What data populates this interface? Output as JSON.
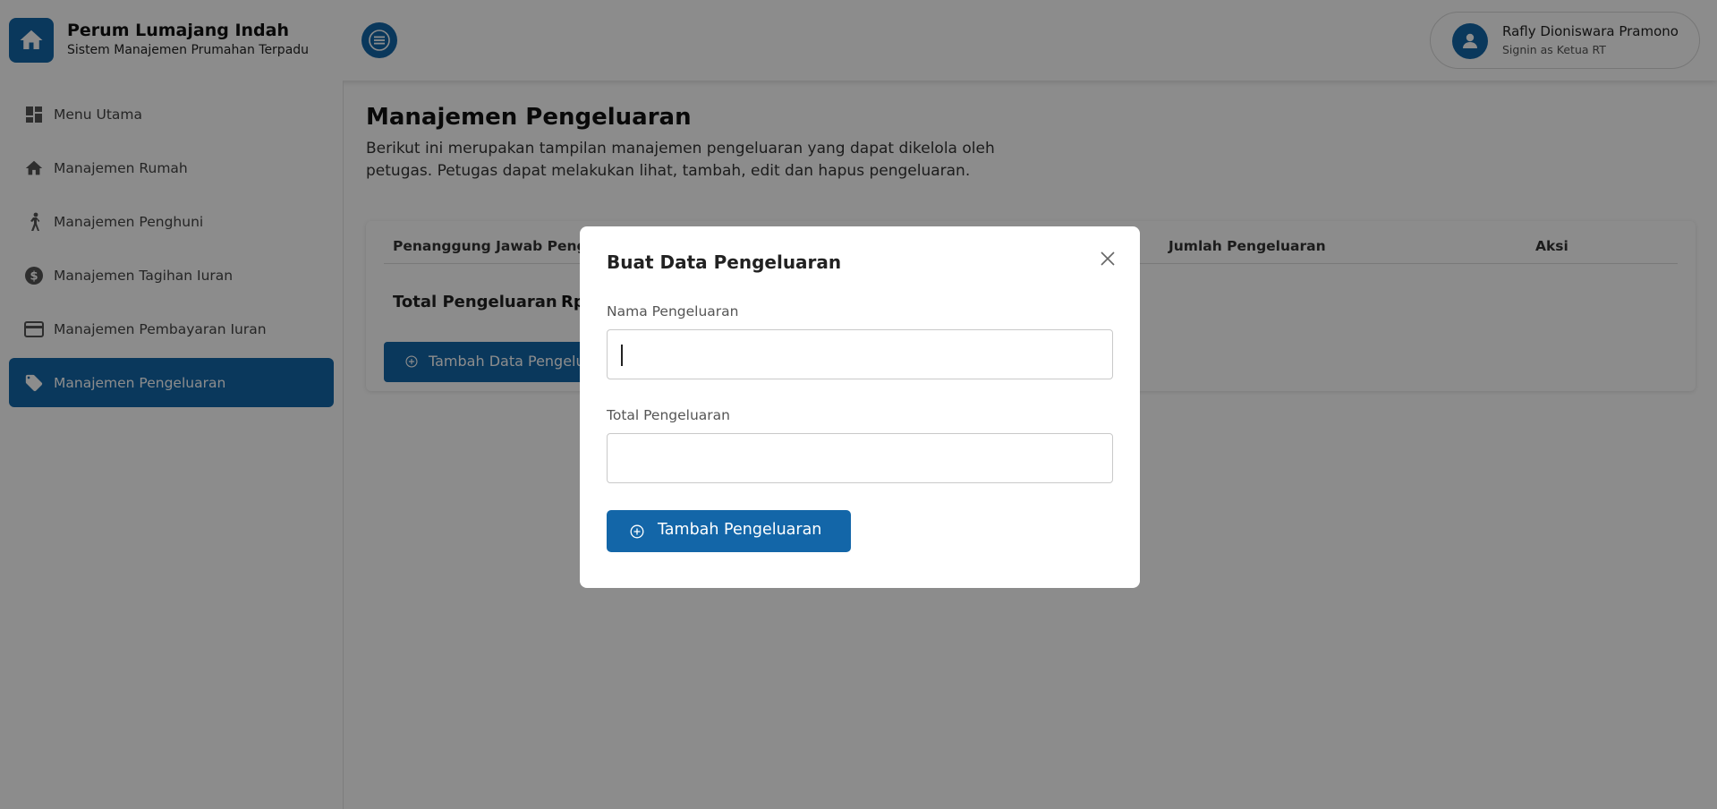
{
  "header": {
    "brand_name": "Perum Lumajang Indah",
    "brand_subtitle": "Sistem Manajemen Prumahan Terpadu",
    "logo_icon": "home-icon",
    "menu_toggle_icon": "hamburger-icon",
    "user": {
      "name": "Rafly Dioniswara Pramono",
      "role": "Signin as Ketua RT",
      "avatar_icon": "user-icon"
    }
  },
  "sidebar": {
    "items": [
      {
        "label": "Menu Utama",
        "icon": "dashboard-icon",
        "active": false
      },
      {
        "label": "Manajemen Rumah",
        "icon": "home-icon",
        "active": false
      },
      {
        "label": "Manajemen Penghuni",
        "icon": "person-icon",
        "active": false
      },
      {
        "label": "Manajemen Tagihan Iuran",
        "icon": "dollar-icon",
        "active": false
      },
      {
        "label": "Manajemen Pembayaran Iuran",
        "icon": "credit-card-icon",
        "active": false
      },
      {
        "label": "Manajemen Pengeluaran",
        "icon": "tag-icon",
        "active": true
      }
    ]
  },
  "main": {
    "title": "Manajemen Pengeluaran",
    "description": "Berikut ini merupakan tampilan manajemen pengeluaran yang dapat dikelola oleh petugas. Petugas dapat melakukan lihat, tambah, edit dan hapus pengeluaran.",
    "table": {
      "columns": [
        "Penanggung Jawab Pengeluaran",
        "Jumlah Pengeluaran",
        "Aksi"
      ]
    },
    "total_label": "Total Pengeluaran",
    "total_value": "Rp",
    "add_button_label": "Tambah Data Pengeluaran"
  },
  "modal": {
    "title": "Buat Data Pengeluaran",
    "close_icon": "close-icon",
    "fields": [
      {
        "label": "Nama Pengeluaran",
        "value": "",
        "placeholder": ""
      },
      {
        "label": "Total Pengeluaran",
        "value": "",
        "placeholder": ""
      }
    ],
    "submit_label": "Tambah Pengeluaran",
    "submit_icon": "plus-circle-icon"
  },
  "colors": {
    "primary": "#1366a8",
    "overlay": "rgba(0,0,0,0.45)"
  }
}
